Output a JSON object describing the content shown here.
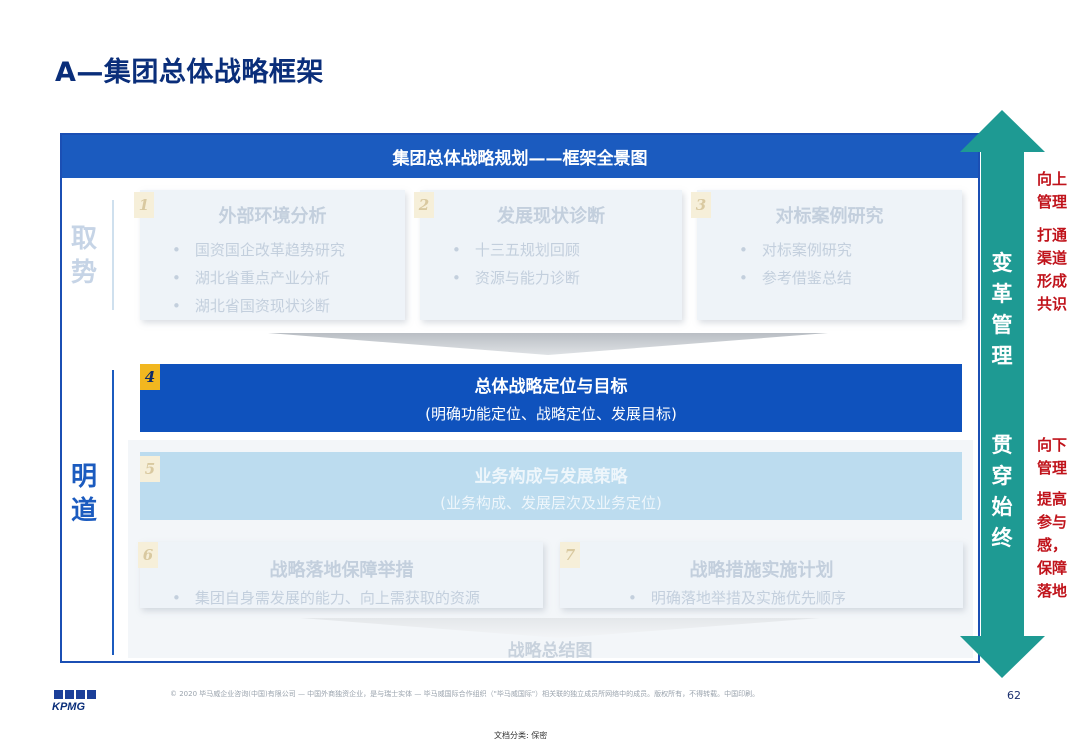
{
  "title": "A—集团总体战略框架",
  "banner": "集团总体战略规划——框架全景图",
  "side_labels": {
    "qushi": "取势",
    "mingdao": "明道"
  },
  "boxes": [
    {
      "num": "1",
      "title": "外部环境分析",
      "items": [
        "国资国企改革趋势研究",
        "湖北省重点产业分析",
        "湖北省国资现状诊断"
      ]
    },
    {
      "num": "2",
      "title": "发展现状诊断",
      "items": [
        "十三五规划回顾",
        "资源与能力诊断"
      ]
    },
    {
      "num": "3",
      "title": "对标案例研究",
      "items": [
        "对标案例研究",
        "参考借鉴总结"
      ]
    },
    {
      "num": "4",
      "title": "总体战略定位与目标",
      "sub": "(明确功能定位、战略定位、发展目标)"
    },
    {
      "num": "5",
      "title": "业务构成与发展策略",
      "sub": "(业务构成、发展层次及业务定位)"
    },
    {
      "num": "6",
      "title": "战略落地保障举措",
      "items": [
        "集团自身需发展的能力、向上需获取的资源"
      ]
    },
    {
      "num": "7",
      "title": "战略措施实施计划",
      "items": [
        "明确落地举措及实施优先顺序"
      ]
    }
  ],
  "summary": "战略总结图",
  "arrow": {
    "top_text": "变革管理",
    "bottom_text": "贯穿始终"
  },
  "notes": [
    {
      "head": "向上管理",
      "body": "打通渠道形成共识"
    },
    {
      "head": "向下管理",
      "body": "提高参与感，保障落地"
    }
  ],
  "footer": {
    "copyright": "© 2020 毕马威企业咨询(中国)有限公司 — 中国外商独资企业，是与瑞士实体 — 毕马威国际合作组织（\"毕马威国际\"）相关联的独立成员所网络中的成员。版权所有，不得转载。中国印刷。",
    "page": "62",
    "logo": "KPMG",
    "doc_class": "文档分类: 保密"
  },
  "colors": {
    "brand_blue": "#1b5bbf",
    "teal_arrow": "#1e9a93",
    "red_note": "#c0131b",
    "step4_badge": "#f2b71f"
  }
}
